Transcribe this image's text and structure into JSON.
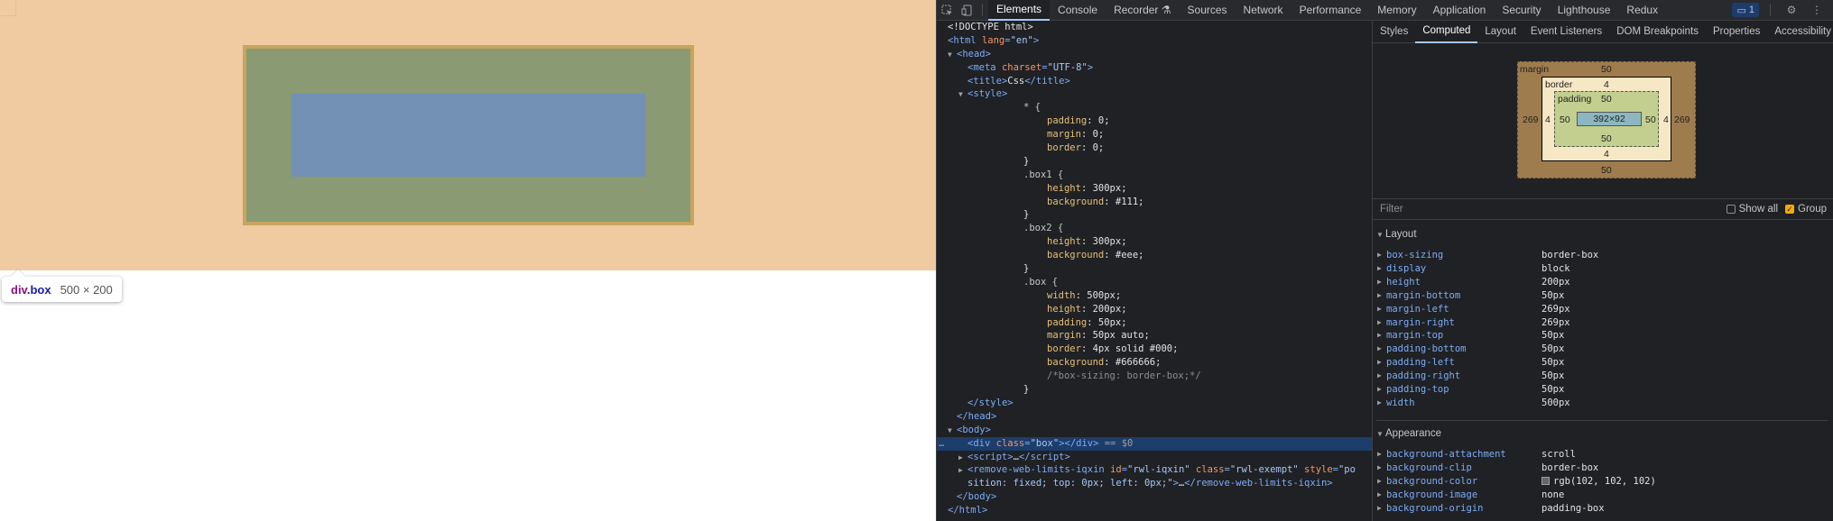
{
  "page": {
    "tooltip": {
      "tag": "div",
      "class": ".box",
      "size": "500 × 200"
    }
  },
  "devtools": {
    "tabs": [
      "Elements",
      "Console",
      "Recorder ⚗",
      "Sources",
      "Network",
      "Performance",
      "Memory",
      "Application",
      "Security",
      "Lighthouse",
      "Redux"
    ],
    "active_tab": "Elements",
    "issues_count": "1",
    "dom": {
      "doctype": "<!DOCTYPE html>",
      "html_open": "html",
      "lang_attr": "lang",
      "lang_val": "\"en\"",
      "head": "head",
      "meta_tag": "meta",
      "charset_attr": "charset",
      "charset_val": "\"UTF-8\"",
      "title_tag": "title",
      "title_text": "Css",
      "style_tag": "style",
      "css": {
        "universal": "* {",
        "padding": "padding",
        "padding_v": "0;",
        "margin": "margin",
        "margin_v": "0;",
        "border": "border",
        "border_v": "0;",
        "close": "}",
        "box1_sel": ".box1 {",
        "box1_height": "height",
        "box1_height_v": "300px;",
        "box1_bg": "background",
        "box1_bg_v": "#111;",
        "box2_sel": ".box2 {",
        "box2_height": "height",
        "box2_height_v": "300px;",
        "box2_bg": "background",
        "box2_bg_v": "#eee;",
        "box_sel": ".box {",
        "width": "width",
        "width_v": "500px;",
        "height": "height",
        "height_v": "200px;",
        "b_padding": "padding",
        "b_padding_v": "50px;",
        "b_margin": "margin",
        "b_margin_v": "50px auto;",
        "b_border": "border",
        "b_border_v": "4px solid #000;",
        "b_bg": "background",
        "b_bg_v": "#666666;",
        "comment": "/*box-sizing: border-box;*/"
      },
      "body": "body",
      "div_tag": "div",
      "class_attr": "class",
      "class_val": "\"box\"",
      "selected_suffix": "== $0",
      "script_tag": "script",
      "ext_tag": "remove-web-limits-iqxin",
      "ext_id_attr": "id",
      "ext_id_val": "\"rwl-iqxin\"",
      "ext_class_attr": "class",
      "ext_class_val": "\"rwl-exempt\"",
      "ext_style_attr": "style",
      "ext_style_val_1": "\"po",
      "ext_style_val_2": "sition: fixed; top: 0px; left: 0px;\"",
      "ellipsis": "…"
    },
    "side_tabs": [
      "Styles",
      "Computed",
      "Layout",
      "Event Listeners",
      "DOM Breakpoints",
      "Properties",
      "Accessibility"
    ],
    "active_side_tab": "Computed",
    "box_model": {
      "margin_label": "margin",
      "margin_top": "50",
      "margin_bottom": "50",
      "margin_left": "269",
      "margin_right": "269",
      "border_label": "border",
      "border_top": "4",
      "border_bottom": "4",
      "border_left": "4",
      "border_right": "4",
      "padding_label": "padding",
      "padding_top": "50",
      "padding_bottom": "50",
      "padding_left": "50",
      "padding_right": "50",
      "content": "392×92"
    },
    "filter": {
      "placeholder": "Filter",
      "show_all": "Show all",
      "group": "Group",
      "show_all_checked": false,
      "group_checked": true
    },
    "layout_section": {
      "title": "Layout",
      "rows": [
        {
          "name": "box-sizing",
          "value": "border-box"
        },
        {
          "name": "display",
          "value": "block"
        },
        {
          "name": "height",
          "value": "200px"
        },
        {
          "name": "margin-bottom",
          "value": "50px"
        },
        {
          "name": "margin-left",
          "value": "269px"
        },
        {
          "name": "margin-right",
          "value": "269px"
        },
        {
          "name": "margin-top",
          "value": "50px"
        },
        {
          "name": "padding-bottom",
          "value": "50px"
        },
        {
          "name": "padding-left",
          "value": "50px"
        },
        {
          "name": "padding-right",
          "value": "50px"
        },
        {
          "name": "padding-top",
          "value": "50px"
        },
        {
          "name": "width",
          "value": "500px"
        }
      ]
    },
    "appearance_section": {
      "title": "Appearance",
      "rows": [
        {
          "name": "background-attachment",
          "value": "scroll"
        },
        {
          "name": "background-clip",
          "value": "border-box"
        },
        {
          "name": "background-color",
          "value": "rgb(102, 102, 102)"
        },
        {
          "name": "background-image",
          "value": "none"
        },
        {
          "name": "background-origin",
          "value": "padding-box"
        }
      ]
    }
  }
}
